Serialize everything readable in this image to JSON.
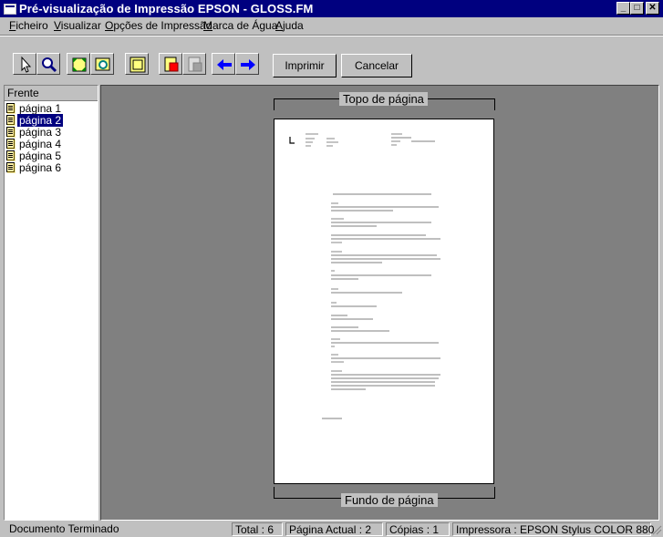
{
  "window": {
    "title": "Pré-visualização de Impressão EPSON - GLOSS.FM",
    "minimize_label": "_",
    "maximize_label": "□",
    "close_label": "✕"
  },
  "menu": {
    "items": [
      {
        "underline": "F",
        "rest": "icheiro"
      },
      {
        "underline": "V",
        "rest": "isualizar"
      },
      {
        "underline": "O",
        "rest": "pções de Impressão"
      },
      {
        "underline": "M",
        "rest": "arca de Água"
      },
      {
        "underline": "A",
        "rest": "juda"
      }
    ]
  },
  "toolbar": {
    "icons": [
      "pointer-icon",
      "zoom-icon",
      "fit-page-icon",
      "zoom-page-icon",
      "margins-icon",
      "add-page-icon",
      "remove-page-icon",
      "previous-page-arrow-icon",
      "next-page-arrow-icon"
    ],
    "print_label": "Imprimir",
    "cancel_label": "Cancelar"
  },
  "sidebar": {
    "header": "Frente",
    "pages": [
      {
        "label": "página 1",
        "selected": false
      },
      {
        "label": "página 2",
        "selected": true
      },
      {
        "label": "página 3",
        "selected": false
      },
      {
        "label": "página 4",
        "selected": false
      },
      {
        "label": "página 5",
        "selected": false
      },
      {
        "label": "página 6",
        "selected": false
      }
    ]
  },
  "preview": {
    "top_label": "Topo de página",
    "bottom_label": "Fundo de página"
  },
  "status": {
    "document": "Documento Terminado",
    "total": "Total : 6",
    "current_page": "Página Actual : 2",
    "copies": "Cópias : 1",
    "printer": "Impressora : EPSON Stylus COLOR 880"
  },
  "colors": {
    "titlebar": "#00007f",
    "face": "#c0c0c0",
    "preview_bg": "#808080",
    "selection": "#00007f"
  }
}
